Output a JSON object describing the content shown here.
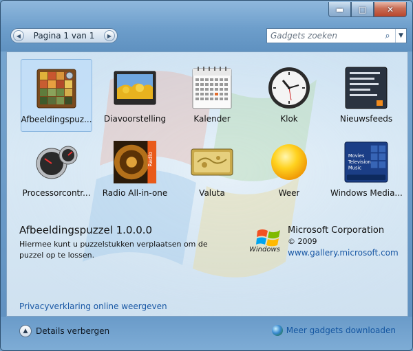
{
  "window": {
    "controls": {
      "minimize": "▬",
      "maximize": "□",
      "close": "✕"
    }
  },
  "pager": {
    "label": "Pagina 1 van 1",
    "prev_icon": "◀",
    "next_icon": "▶"
  },
  "search": {
    "placeholder": "Gadgets zoeken",
    "icon": "⌕",
    "dropdown_icon": "▼"
  },
  "gadgets": [
    {
      "label": "Afbeeldingspuz...",
      "icon": "picture-puzzle-icon",
      "selected": true
    },
    {
      "label": "Diavoorstelling",
      "icon": "slideshow-icon"
    },
    {
      "label": "Kalender",
      "icon": "calendar-icon",
      "calendar_month": "OCT 06"
    },
    {
      "label": "Klok",
      "icon": "clock-icon"
    },
    {
      "label": "Nieuwsfeeds",
      "icon": "newsfeed-icon"
    },
    {
      "label": "Processorcontr...",
      "icon": "cpu-meter-icon"
    },
    {
      "label": "Radio All-in-one",
      "icon": "radio-speaker-icon",
      "badge": "Radio"
    },
    {
      "label": "Valuta",
      "icon": "currency-icon"
    },
    {
      "label": "Weer",
      "icon": "weather-sun-icon"
    },
    {
      "label": "Windows Media...",
      "icon": "windows-media-center-icon",
      "menu": [
        "Movies",
        "Television",
        "Music"
      ]
    }
  ],
  "details": {
    "name": "Afbeeldingspuzzel 1.0.0.0",
    "description": "Hiermee kunt u puzzelstukken verplaatsen om de puzzel op te lossen.",
    "publisher": "Microsoft Corporation",
    "year": "© 2009",
    "website": "www.gallery.microsoft.com",
    "logo_text": "Windows"
  },
  "privacy_link": "Privacyverklaring online weergeven",
  "footer": {
    "toggle_label": "Details verbergen",
    "toggle_icon": "▲",
    "more_label": "Meer gadgets downloaden"
  },
  "colors": {
    "link": "#1857a4",
    "selection": "#bedcf8"
  }
}
